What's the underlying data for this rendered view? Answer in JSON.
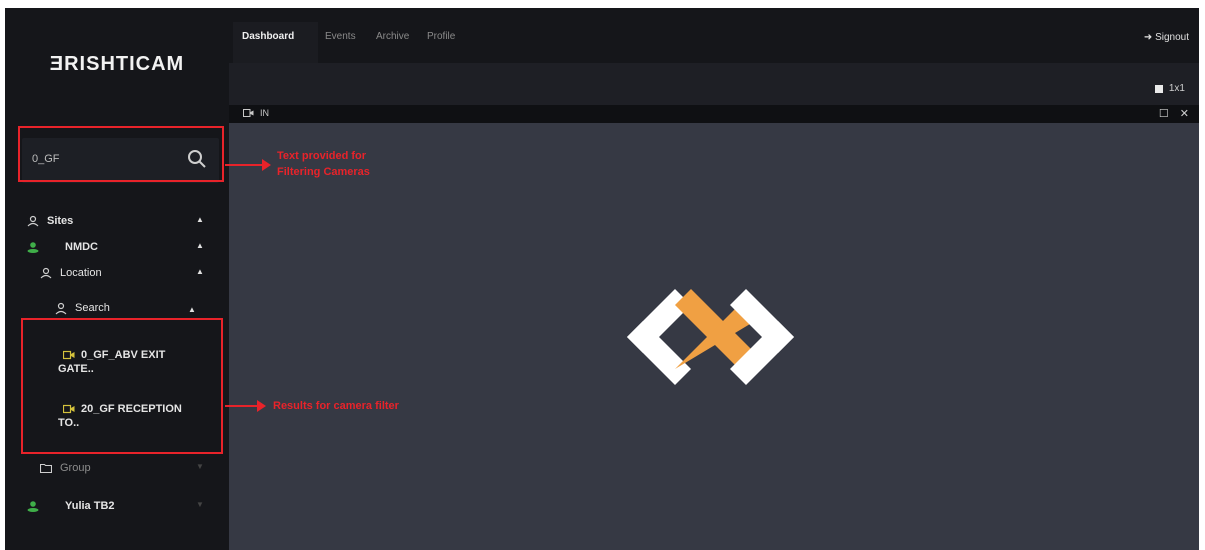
{
  "app": {
    "logo_text": "ƎRISHTICAM"
  },
  "colors": {
    "sidebar_bg": "#15161a",
    "viewport_bg": "#363944",
    "annotation_red": "#e8232a",
    "logo_white": "#ffffff",
    "logo_orange": "#f0a043",
    "tree_green": "#3fae49",
    "camera_yellow": "#d4c23c"
  },
  "search": {
    "value": "0_GF"
  },
  "tree": {
    "sites_label": "Sites",
    "site_label": "NMDC",
    "location_label": "Location",
    "search_node_label": "Search",
    "results": [
      {
        "icon": "camera-icon",
        "line1": "0_GF_ABV EXIT",
        "line2": "GATE.."
      },
      {
        "icon": "camera-icon",
        "line1": "20_GF RECEPTION",
        "line2": "TO.."
      }
    ],
    "group_label": "Group",
    "site2_label": "Yulia TB2"
  },
  "annotations": {
    "search_note_line1": "Text provided for",
    "search_note_line2": "Filtering Cameras",
    "results_note": "Results for camera filter"
  },
  "header": {
    "tabs": [
      "Dashboard",
      "Events",
      "Archive",
      "Profile"
    ],
    "active_tab": "Dashboard",
    "signout_label": "Signout"
  },
  "layout": {
    "selected": "1x1"
  },
  "camera_panel": {
    "label": "IN"
  }
}
